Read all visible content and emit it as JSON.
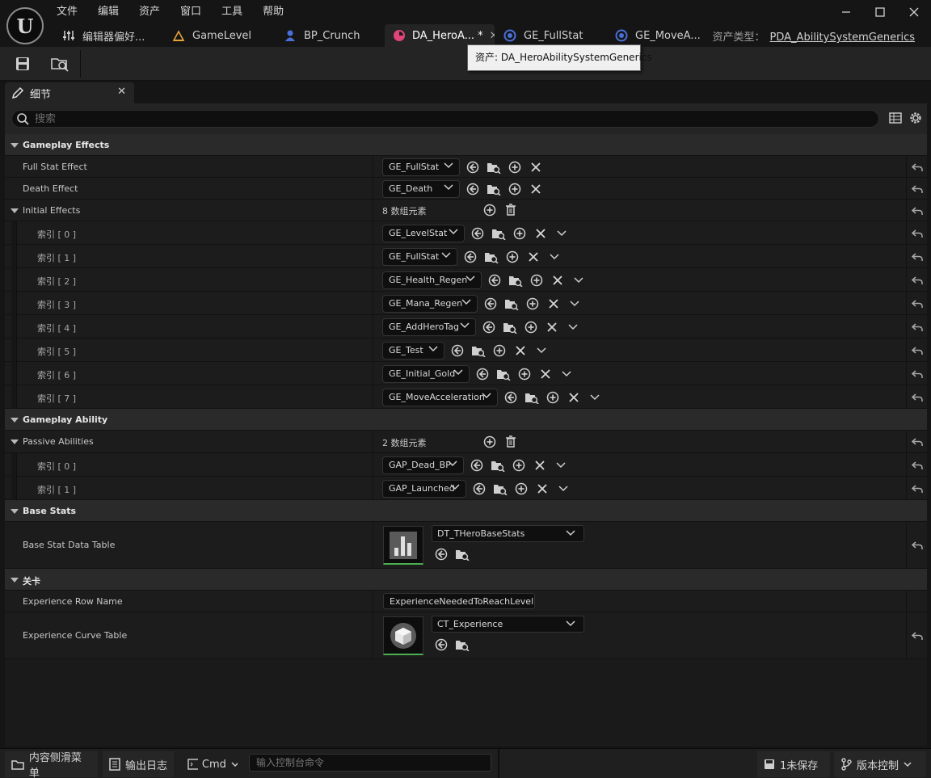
{
  "window": {
    "menu": [
      "文件",
      "编辑",
      "资产",
      "窗口",
      "工具",
      "帮助"
    ],
    "controls": {
      "minimize": "—",
      "maximize": "☐",
      "close": "✕"
    }
  },
  "tabs": [
    {
      "label": "编辑器偏好...",
      "icon": "sliders-icon"
    },
    {
      "label": "GameLevel",
      "icon": "level-icon"
    },
    {
      "label": "BP_Crunch",
      "icon": "blueprint-icon"
    },
    {
      "label": "DA_HeroA... *",
      "icon": "data-asset-icon",
      "active": true
    },
    {
      "label": "GE_FullStat",
      "icon": "gameplay-effect-icon"
    },
    {
      "label": "GE_MoveA...",
      "icon": "gameplay-effect-icon"
    }
  ],
  "asset_type": {
    "label": "资产类型：",
    "value": "PDA_AbilitySystemGenerics"
  },
  "tooltip": "资产: DA_HeroAbilitySystemGenerics",
  "details": {
    "tab_label": "细节",
    "search_placeholder": "搜索",
    "sections": {
      "gameplay_effects": "Gameplay Effects",
      "gameplay_ability": "Gameplay Ability",
      "base_stats": "Base Stats",
      "level": "关卡"
    },
    "full_stat_effect": {
      "label": "Full Stat Effect",
      "value": "GE_FullStat"
    },
    "death_effect": {
      "label": "Death Effect",
      "value": "GE_Death"
    },
    "initial_effects": {
      "label": "Initial Effects",
      "count": "8 数组元素",
      "items": [
        {
          "index": "索引 [ 0 ]",
          "value": "GE_LevelStat"
        },
        {
          "index": "索引 [ 1 ]",
          "value": "GE_FullStat"
        },
        {
          "index": "索引 [ 2 ]",
          "value": "GE_Health_Regen"
        },
        {
          "index": "索引 [ 3 ]",
          "value": "GE_Mana_Regen"
        },
        {
          "index": "索引 [ 4 ]",
          "value": "GE_AddHeroTag"
        },
        {
          "index": "索引 [ 5 ]",
          "value": "GE_Test"
        },
        {
          "index": "索引 [ 6 ]",
          "value": "GE_Initial_Gold"
        },
        {
          "index": "索引 [ 7 ]",
          "value": "GE_MoveAcceleration"
        }
      ]
    },
    "passive_abilities": {
      "label": "Passive Abilities",
      "count": "2 数组元素",
      "items": [
        {
          "index": "索引 [ 0 ]",
          "value": "GAP_Dead_BP"
        },
        {
          "index": "索引 [ 1 ]",
          "value": "GAP_Launched"
        }
      ]
    },
    "base_stat_data_table": {
      "label": "Base Stat Data Table",
      "value": "DT_THeroBaseStats"
    },
    "experience_row_name": {
      "label": "Experience Row Name",
      "value": "ExperienceNeededToReachLevel"
    },
    "experience_curve_table": {
      "label": "Experience Curve Table",
      "value": "CT_Experience"
    }
  },
  "statusbar": {
    "content_drawer": "内容侧滑菜单",
    "output_log": "输出日志",
    "cmd": "Cmd",
    "console_placeholder": "输入控制台命令",
    "unsaved": "1未保存",
    "source_control": "版本控制"
  },
  "colors": {
    "accent_green": "#4caf50",
    "active_tab_icon": "#e0447a",
    "ge_icon": "#4a6fd8"
  }
}
